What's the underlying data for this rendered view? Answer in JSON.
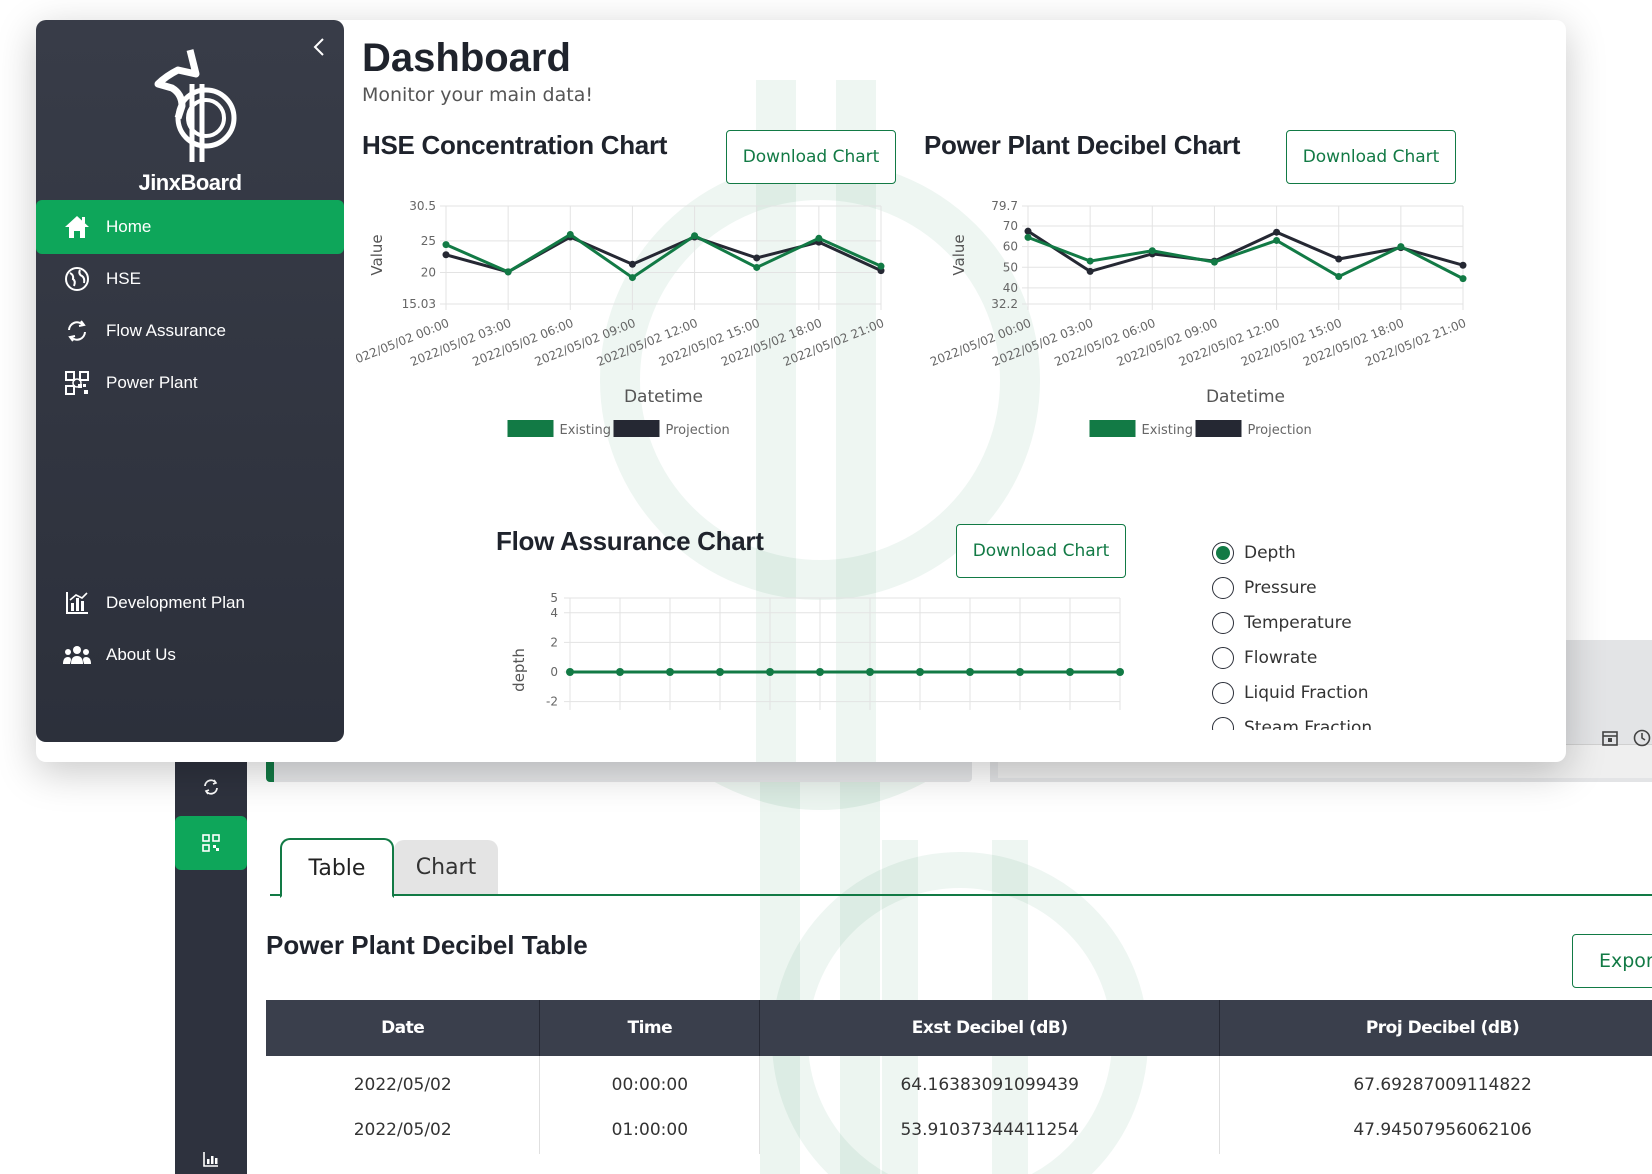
{
  "app": {
    "brand": "JinxBoard"
  },
  "dashboard": {
    "title": "Dashboard",
    "subtitle": "Monitor your main data!"
  },
  "sidebar": {
    "items": [
      {
        "label": "Home",
        "icon": "home-icon",
        "active": true
      },
      {
        "label": "HSE",
        "icon": "globe-icon"
      },
      {
        "label": "Flow Assurance",
        "icon": "recycle-icon"
      },
      {
        "label": "Power Plant",
        "icon": "qr-icon"
      }
    ],
    "bottom_items": [
      {
        "label": "Development Plan",
        "icon": "chart-icon"
      },
      {
        "label": "About Us",
        "icon": "users-icon"
      }
    ]
  },
  "download_label": "Download Chart",
  "legend": {
    "existing": "Existing",
    "projection": "Projection"
  },
  "colors": {
    "existing": "#127a45",
    "projection": "#252833",
    "accent": "#0ea65a",
    "sidebar": "#383c48"
  },
  "radio_options": [
    "Depth",
    "Pressure",
    "Temperature",
    "Flowrate",
    "Liquid Fraction",
    "Steam Fraction"
  ],
  "radio_selected": "Depth",
  "back_page": {
    "tabs": [
      "Table",
      "Chart"
    ],
    "table_title": "Power Plant Decibel Table",
    "export_label": "Expor",
    "columns": [
      "Date",
      "Time",
      "Exst Decibel (dB)",
      "Proj Decibel (dB)"
    ],
    "rows": [
      [
        "2022/05/02",
        "00:00:00",
        "64.16383091099439",
        "67.69287009114822"
      ],
      [
        "2022/05/02",
        "01:00:00",
        "53.91037344411254",
        "47.94507956062106"
      ]
    ]
  },
  "chart_data": [
    {
      "type": "line",
      "title": "HSE Concentration Chart",
      "xlabel": "Datetime",
      "ylabel": "Value",
      "ylim": [
        15.03,
        30.5
      ],
      "yticks": [
        15.03,
        20,
        25,
        30.5
      ],
      "categories": [
        "2022/05/02 00:00",
        "2022/05/02 03:00",
        "2022/05/02 06:00",
        "2022/05/02 09:00",
        "2022/05/02 12:00",
        "2022/05/02 15:00",
        "2022/05/02 18:00",
        "2022/05/02 21:00"
      ],
      "series": [
        {
          "name": "Existing",
          "values": [
            24.4,
            20.1,
            26.0,
            19.2,
            25.8,
            20.8,
            25.4,
            21.0
          ]
        },
        {
          "name": "Projection",
          "values": [
            22.8,
            20.1,
            25.6,
            21.3,
            25.6,
            22.3,
            24.8,
            20.3
          ]
        }
      ],
      "grid": true,
      "legend": "bottom"
    },
    {
      "type": "line",
      "title": "Power Plant Decibel Chart",
      "xlabel": "Datetime",
      "ylabel": "Value",
      "ylim": [
        32.2,
        79.7
      ],
      "yticks": [
        32.2,
        40,
        50,
        60,
        70,
        79.7
      ],
      "categories": [
        "2022/05/02 00:00",
        "2022/05/02 03:00",
        "2022/05/02 06:00",
        "2022/05/02 09:00",
        "2022/05/02 12:00",
        "2022/05/02 15:00",
        "2022/05/02 18:00",
        "2022/05/02 21:00"
      ],
      "series": [
        {
          "name": "Existing",
          "values": [
            64.5,
            53.0,
            58.0,
            52.5,
            63.0,
            45.5,
            60.0,
            44.5
          ]
        },
        {
          "name": "Projection",
          "values": [
            67.5,
            48.0,
            56.5,
            53.0,
            67.0,
            54.0,
            59.5,
            51.0
          ]
        }
      ],
      "grid": true,
      "legend": "bottom"
    },
    {
      "type": "line",
      "title": "Flow Assurance Chart",
      "ylabel": "depth",
      "ylim": [
        -2,
        5
      ],
      "yticks": [
        -2,
        0,
        2,
        4,
        5
      ],
      "series": [
        {
          "name": "Existing",
          "values": [
            0,
            0,
            0,
            0,
            0,
            0,
            0,
            0,
            0,
            0,
            0,
            0
          ]
        }
      ],
      "grid": true
    }
  ]
}
